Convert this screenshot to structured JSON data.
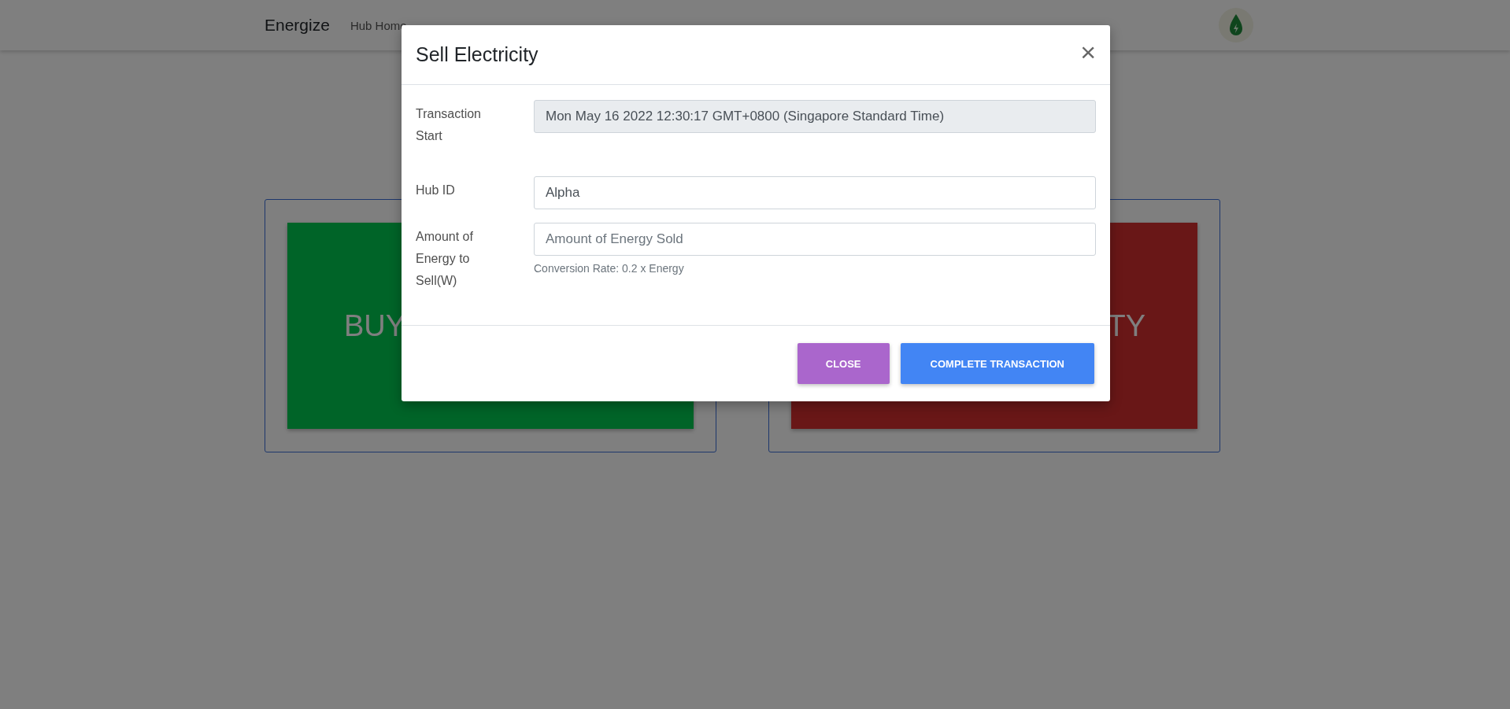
{
  "navbar": {
    "brand": "Energize",
    "links": [
      {
        "label": "Hub Home"
      }
    ]
  },
  "cards": [
    {
      "label": "BUY",
      "kind": "buy"
    },
    {
      "label": "TY",
      "kind": "sell"
    }
  ],
  "modal": {
    "title": "Sell Electricity",
    "close_icon": "×",
    "fields": [
      {
        "label": "Transaction Start",
        "value": "Mon May 16 2022 12:30:17 GMT+0800 (Singapore Standard Time)",
        "disabled": true
      },
      {
        "label": "Hub ID",
        "value": "Alpha",
        "disabled": false
      },
      {
        "label": "Amount of Energy to Sell(W)",
        "placeholder": "Amount of Energy Sold",
        "help": "Conversion Rate: 0.2 x Energy",
        "disabled": false
      }
    ],
    "buttons": [
      {
        "label": "CLOSE",
        "kind": "secondary"
      },
      {
        "label": "COMPLETE TRANSACTION",
        "kind": "primary"
      }
    ]
  }
}
